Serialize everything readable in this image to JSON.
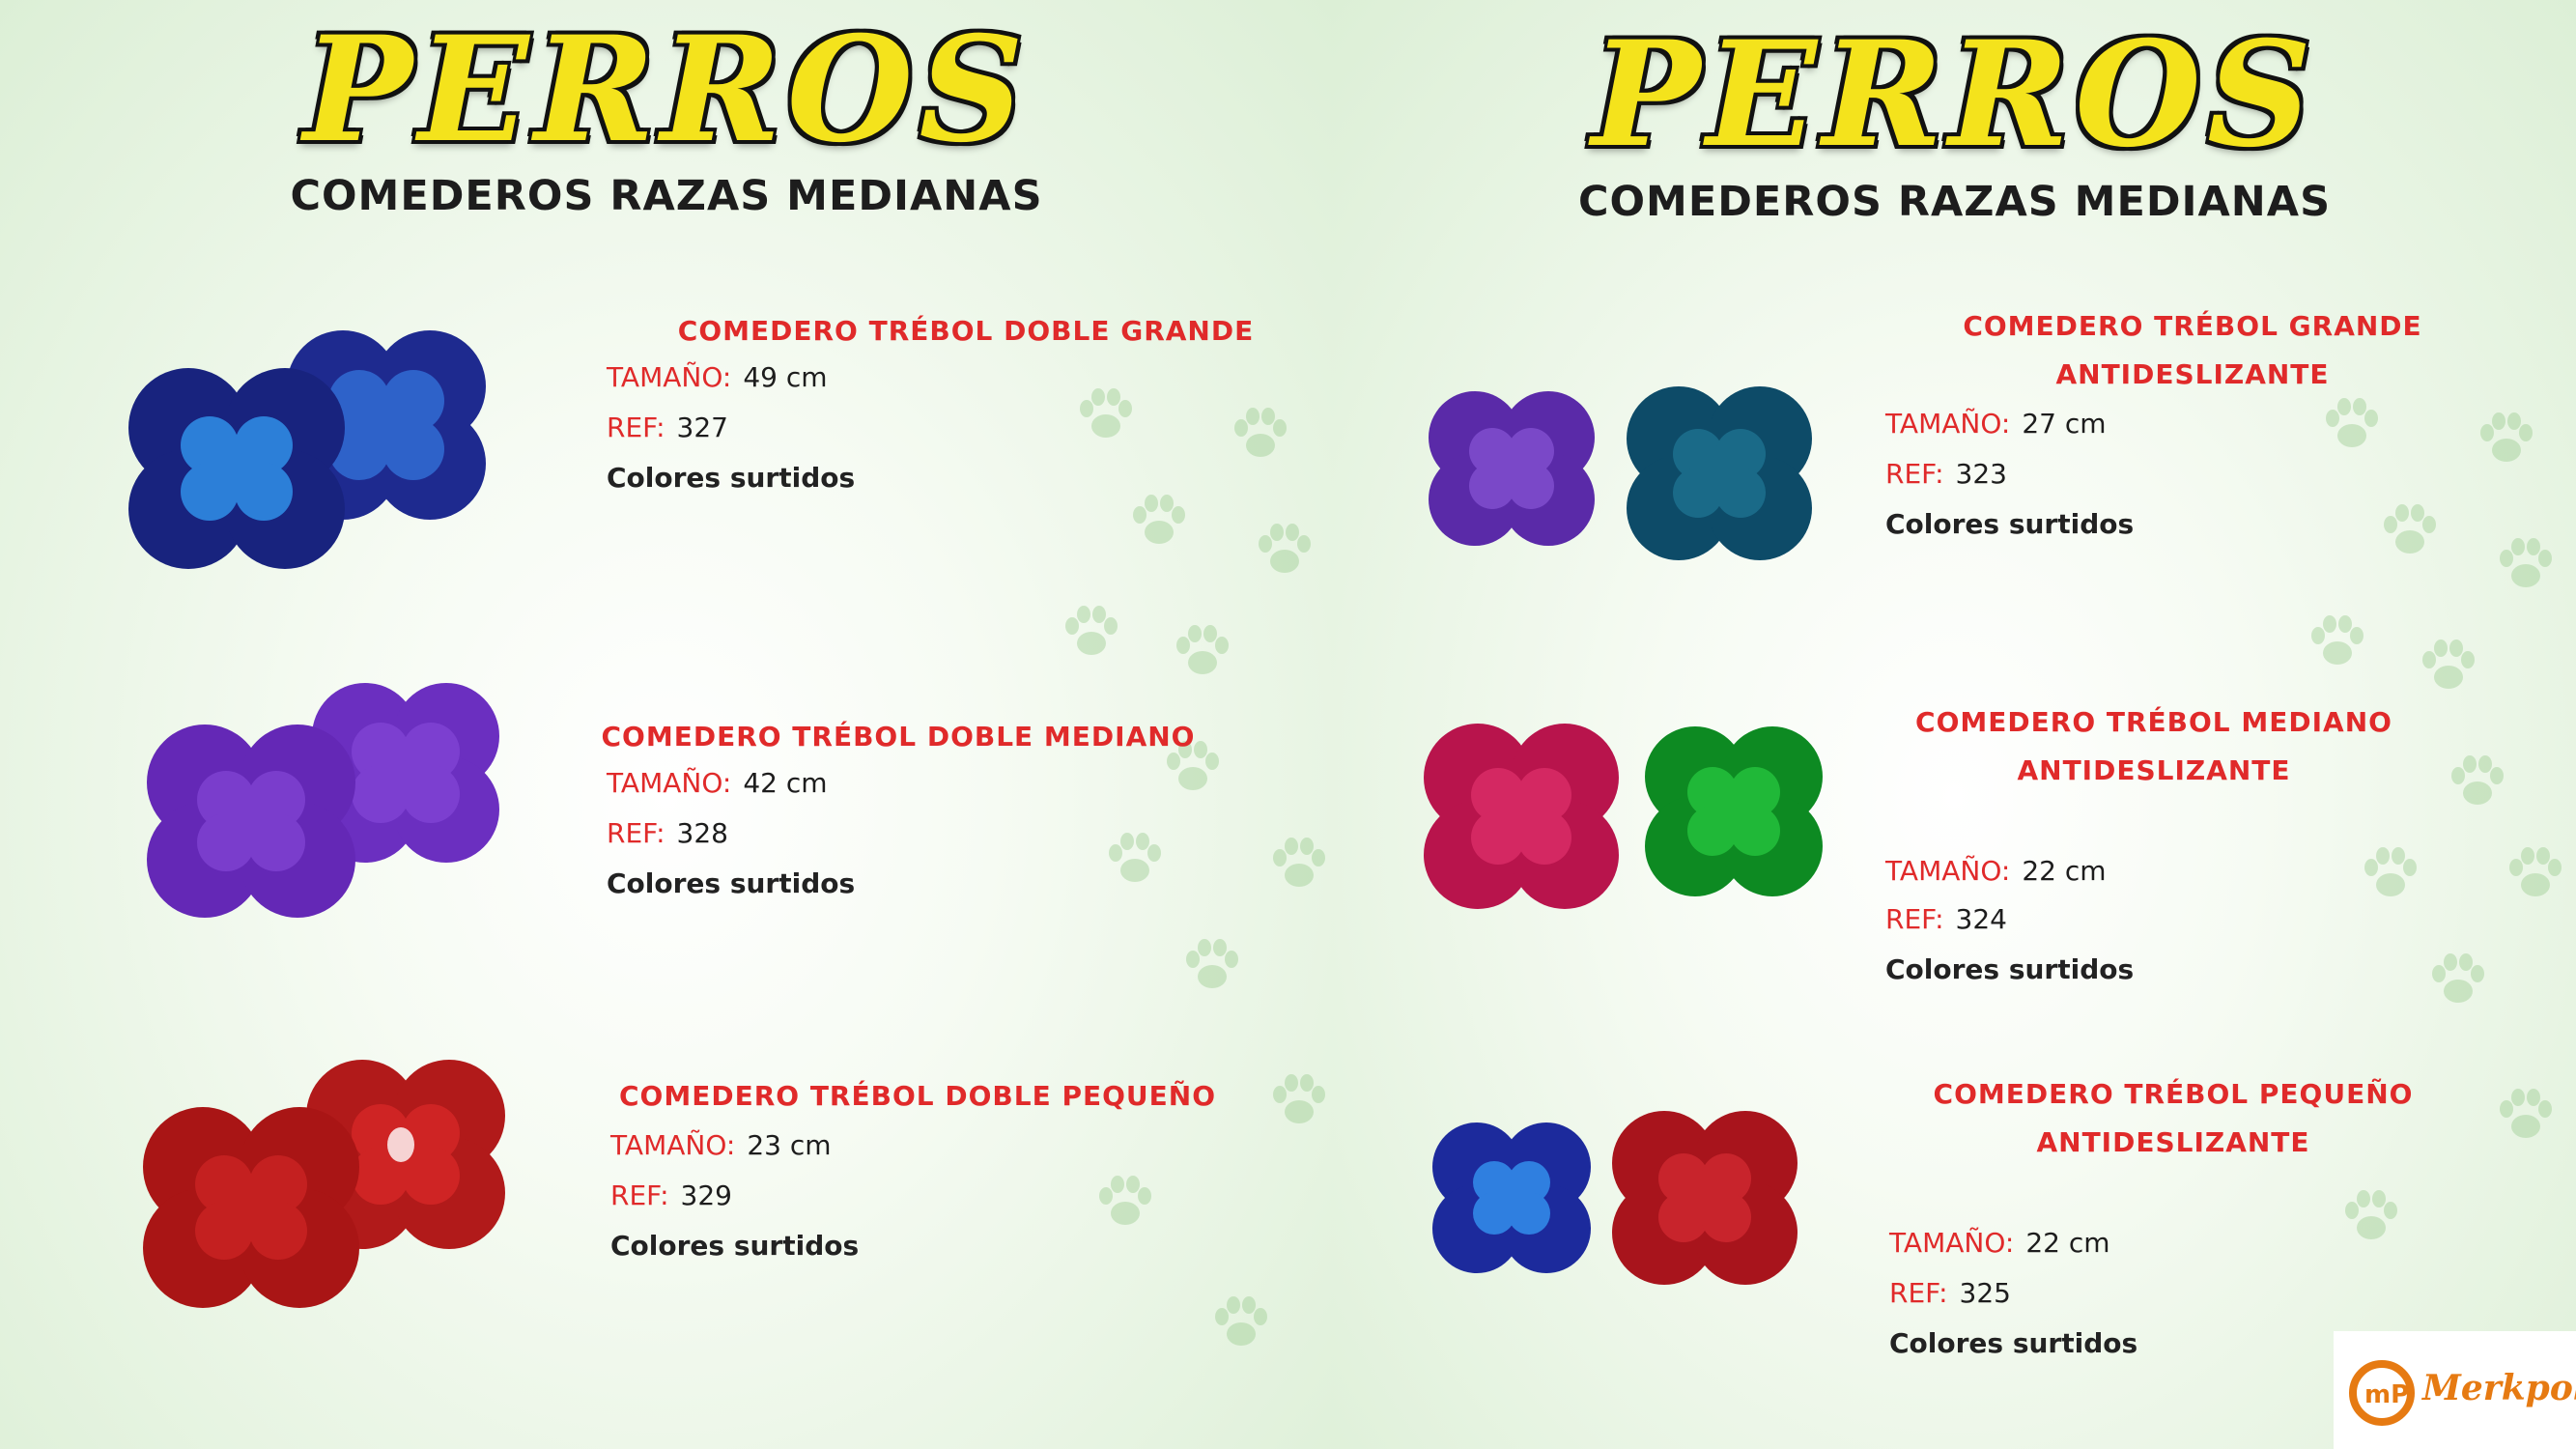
{
  "brand": "PERROS",
  "subtitle": "COMEDEROS RAZAS MEDIANAS",
  "left_products": [
    {
      "title": "COMEDERO TRÉBOL DOBLE GRANDE",
      "size_label": "TAMAÑO:",
      "size": "49 cm",
      "ref_label": "REF:",
      "ref": "327",
      "colors": "Colores surtidos"
    },
    {
      "title": "COMEDERO TRÉBOL  DOBLE MEDIANO",
      "size_label": "TAMAÑO:",
      "size": "42 cm",
      "ref_label": "REF:",
      "ref": "328",
      "colors": "Colores surtidos"
    },
    {
      "title": "COMEDERO  TRÉBOL  DOBLE PEQUEÑO",
      "size_label": "TAMAÑO:",
      "size": "23 cm",
      "ref_label": "REF:",
      "ref": "329",
      "colors": "Colores surtidos"
    }
  ],
  "right_products": [
    {
      "title_line1": "COMEDERO TRÉBOL GRANDE",
      "title_line2": "ANTIDESLIZANTE",
      "size_label": "TAMAÑO:",
      "size": "27 cm",
      "ref_label": "REF:",
      "ref": "323",
      "colors": "Colores surtidos"
    },
    {
      "title_line1": "COMEDERO TRÉBOL MEDIANO",
      "title_line2": "ANTIDESLIZANTE",
      "size_label": "TAMAÑO:",
      "size": "22 cm",
      "ref_label": "REF:",
      "ref": "324",
      "colors": "Colores surtidos"
    },
    {
      "title_line1": "COMEDERO  TRÉBOL PEQUEÑO",
      "title_line2": "ANTIDESLIZANTE",
      "size_label": "TAMAÑO:",
      "size": "22 cm",
      "ref_label": "REF:",
      "ref": "325",
      "colors": "Colores surtidos"
    }
  ],
  "logo": {
    "mark": "mP",
    "name": "Merkpol"
  },
  "colors": {
    "accent_red": "#e02a2a",
    "brand_yellow": "#f4e31c",
    "paw_green": "#9fce94",
    "logo_orange": "#e67a12"
  },
  "icons": {
    "paw": "paw-print-icon",
    "bowl": "clover-bowl-icon"
  }
}
